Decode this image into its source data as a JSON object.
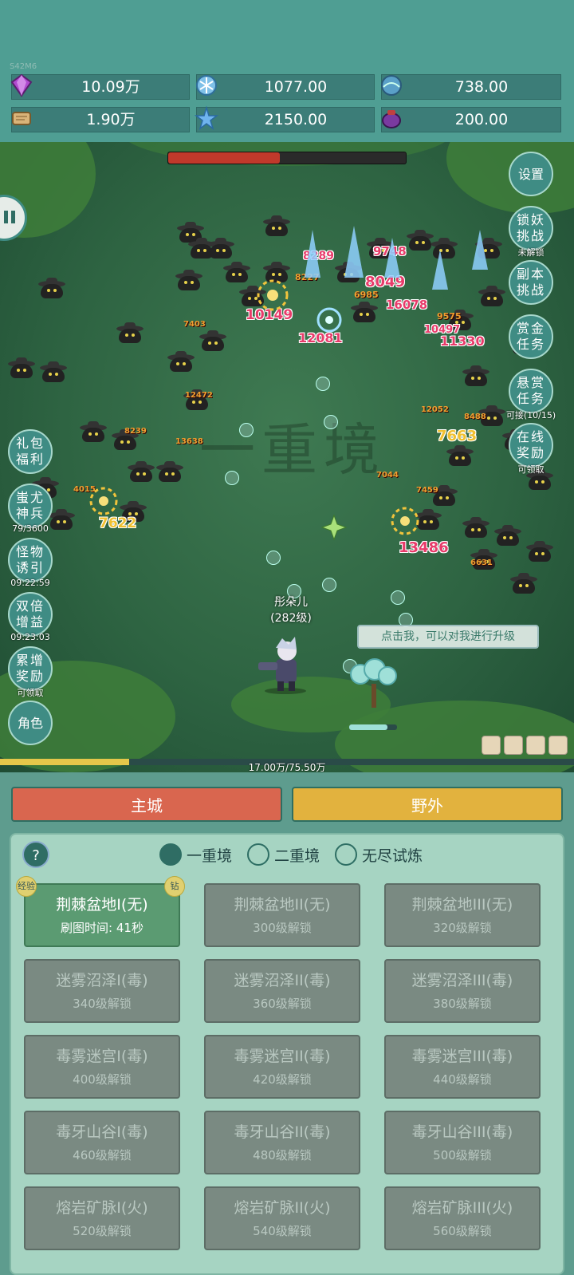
{
  "version": "S42M6",
  "resources": [
    {
      "name": "purple-gem",
      "value": "10.09万",
      "color": "#b04ad0"
    },
    {
      "name": "ice-crystal",
      "value": "1077.00",
      "color": "#7fc0e8"
    },
    {
      "name": "blue-orb",
      "value": "738.00",
      "color": "#5aa0c8"
    },
    {
      "name": "scroll",
      "value": "1.90万",
      "color": "#d9b479"
    },
    {
      "name": "star-shard",
      "value": "2150.00",
      "color": "#6fb4ee"
    },
    {
      "name": "purple-pot",
      "value": "200.00",
      "color": "#7a3aa0"
    }
  ],
  "battle": {
    "boss_hp_fraction": 0.47,
    "realm_watermark": "一重境",
    "player_name": "彤朵儿",
    "player_level": "(282级)",
    "hint": "点击我，可以对我进行升级",
    "damage_numbers": [
      "8289",
      "9748",
      "8227",
      "8049",
      "6985",
      "10149",
      "12081",
      "16078",
      "9575",
      "10497",
      "11330",
      "7663",
      "7622",
      "13486",
      "7403",
      "12472",
      "8239",
      "13638",
      "7044",
      "7459",
      "6631",
      "4015",
      "8488",
      "12052"
    ]
  },
  "right_buttons": [
    {
      "label": "设置",
      "sub": ""
    },
    {
      "label": "锁妖挑战",
      "sub": "未解锁"
    },
    {
      "label": "副本挑战",
      "sub": ""
    },
    {
      "label": "赏金任务",
      "sub": ""
    },
    {
      "label": "悬赏任务",
      "sub": "可接(10/15)"
    },
    {
      "label": "在线奖励",
      "sub": "可领取"
    }
  ],
  "left_buttons": [
    {
      "label": "礼包福利",
      "sub": ""
    },
    {
      "label": "蚩尤神兵",
      "sub": "79/3600"
    },
    {
      "label": "怪物诱引",
      "sub": "09:22:59"
    },
    {
      "label": "双倍增益",
      "sub": "09:23:03"
    },
    {
      "label": "累增奖励",
      "sub": "可领取"
    },
    {
      "label": "角色",
      "sub": ""
    }
  ],
  "xp": {
    "text": "17.00万/75.50万",
    "fraction": 0.225
  },
  "tabs": {
    "main_city": "主城",
    "wild": "野外"
  },
  "panel": {
    "help": "?",
    "realms": [
      "一重境",
      "二重境",
      "无尽试炼"
    ],
    "selected_realm": 0,
    "badge_exp": "经验",
    "badge_diamond": "钻",
    "maps": [
      {
        "name": "荆棘盆地I(无)",
        "sub": "刷图时间: 41秒",
        "active": true
      },
      {
        "name": "荆棘盆地II(无)",
        "sub": "300级解锁"
      },
      {
        "name": "荆棘盆地III(无)",
        "sub": "320级解锁"
      },
      {
        "name": "迷雾沼泽I(毒)",
        "sub": "340级解锁"
      },
      {
        "name": "迷雾沼泽II(毒)",
        "sub": "360级解锁"
      },
      {
        "name": "迷雾沼泽III(毒)",
        "sub": "380级解锁"
      },
      {
        "name": "毒雾迷宫I(毒)",
        "sub": "400级解锁"
      },
      {
        "name": "毒雾迷宫II(毒)",
        "sub": "420级解锁"
      },
      {
        "name": "毒雾迷宫III(毒)",
        "sub": "440级解锁"
      },
      {
        "name": "毒牙山谷I(毒)",
        "sub": "460级解锁"
      },
      {
        "name": "毒牙山谷II(毒)",
        "sub": "480级解锁"
      },
      {
        "name": "毒牙山谷III(毒)",
        "sub": "500级解锁"
      },
      {
        "name": "熔岩矿脉I(火)",
        "sub": "520级解锁"
      },
      {
        "name": "熔岩矿脉II(火)",
        "sub": "540级解锁"
      },
      {
        "name": "熔岩矿脉III(火)",
        "sub": "560级解锁"
      }
    ]
  }
}
